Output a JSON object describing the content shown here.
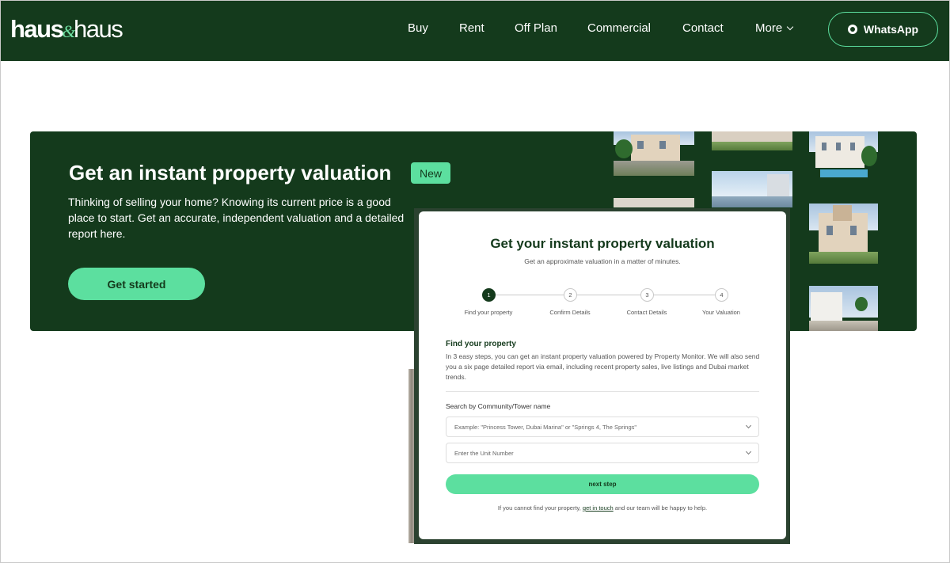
{
  "header": {
    "logo": {
      "part1": "haus",
      "amp": "&",
      "part2": "haus"
    },
    "nav": [
      {
        "label": "Buy"
      },
      {
        "label": "Rent"
      },
      {
        "label": "Off Plan"
      },
      {
        "label": "Commercial"
      },
      {
        "label": "Contact"
      },
      {
        "label": "More"
      }
    ],
    "whatsapp_label": "WhatsApp"
  },
  "hero": {
    "title": "Get an instant property valuation",
    "badge": "New",
    "description": "Thinking of selling your home? Knowing its current price is a good place to start. Get an accurate, independent valuation and a detailed report here.",
    "cta_label": "Get started"
  },
  "valuation_form": {
    "title": "Get your instant property valuation",
    "subtitle": "Get an approximate valuation in a matter of minutes.",
    "steps": [
      {
        "number": "1",
        "label": "Find your property",
        "active": true
      },
      {
        "number": "2",
        "label": "Confirm Details",
        "active": false
      },
      {
        "number": "3",
        "label": "Contact Details",
        "active": false
      },
      {
        "number": "4",
        "label": "Your Valuation",
        "active": false
      }
    ],
    "section_title": "Find your property",
    "section_text": "In 3 easy steps, you can get an instant property valuation powered by Property Monitor. We will also send you a six page detailed report via email, including recent property sales, live listings and Dubai market trends.",
    "search_label": "Search by Community/Tower name",
    "community_placeholder": "Example: \"Princess Tower, Dubai Marina\" or \"Springs 4, The Springs\"",
    "unit_placeholder": "Enter the Unit Number",
    "next_label": "next step",
    "footer_prefix": "If you cannot find your property,",
    "footer_link": "get in touch",
    "footer_suffix": "and our team will be happy to help."
  },
  "colors": {
    "brand_dark_green": "#143a1c",
    "accent_mint": "#5cdf9f"
  }
}
